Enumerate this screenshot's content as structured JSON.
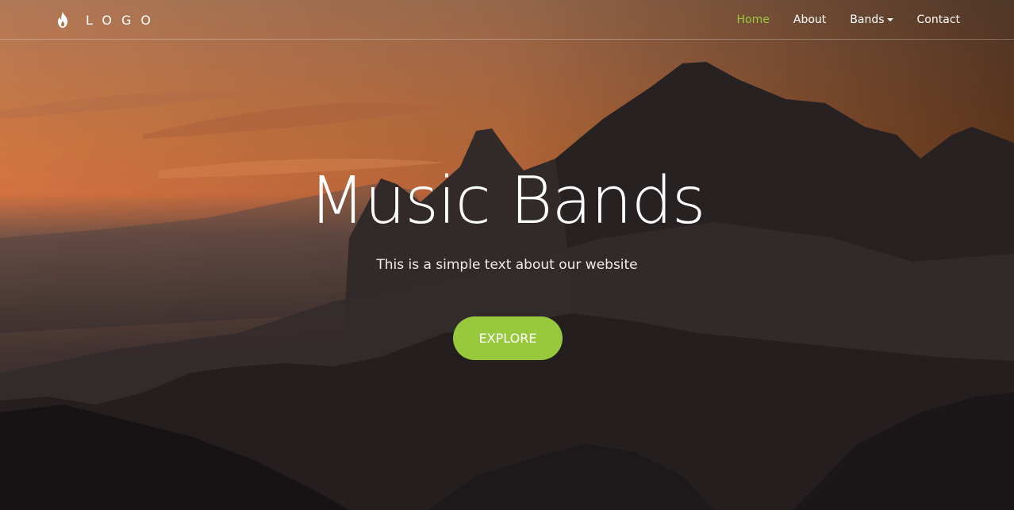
{
  "logo": {
    "text": "LOGO",
    "icon": "flame-icon"
  },
  "nav": {
    "items": [
      {
        "label": "Home",
        "active": true
      },
      {
        "label": "About",
        "active": false
      },
      {
        "label": "Bands",
        "active": false,
        "dropdown": true
      },
      {
        "label": "Contact",
        "active": false
      }
    ]
  },
  "hero": {
    "title": "Music Bands",
    "subtitle": "This is a simple text about our website",
    "cta_label": "EXPLORE",
    "background": "mountain-sunset-image"
  },
  "colors": {
    "accent": "#98c93c",
    "text": "#ffffff"
  }
}
